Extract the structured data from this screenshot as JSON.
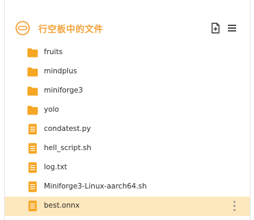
{
  "panel": {
    "title": "行空板中的文件",
    "accent_color": "#f4a23a",
    "logo_icon": "unihiker-board-icon",
    "new_file_icon": "new-file-icon",
    "menu_icon": "hamburger-menu-icon"
  },
  "files": [
    {
      "name": "fruits",
      "type": "folder"
    },
    {
      "name": "mindplus",
      "type": "folder"
    },
    {
      "name": "miniforge3",
      "type": "folder"
    },
    {
      "name": "yolo",
      "type": "folder"
    },
    {
      "name": "condatest.py",
      "type": "file"
    },
    {
      "name": "hell_script.sh",
      "type": "file"
    },
    {
      "name": "log.txt",
      "type": "file"
    },
    {
      "name": "Miniforge3-Linux-aarch64.sh",
      "type": "file"
    },
    {
      "name": "best.onnx",
      "type": "file",
      "selected": true
    }
  ]
}
